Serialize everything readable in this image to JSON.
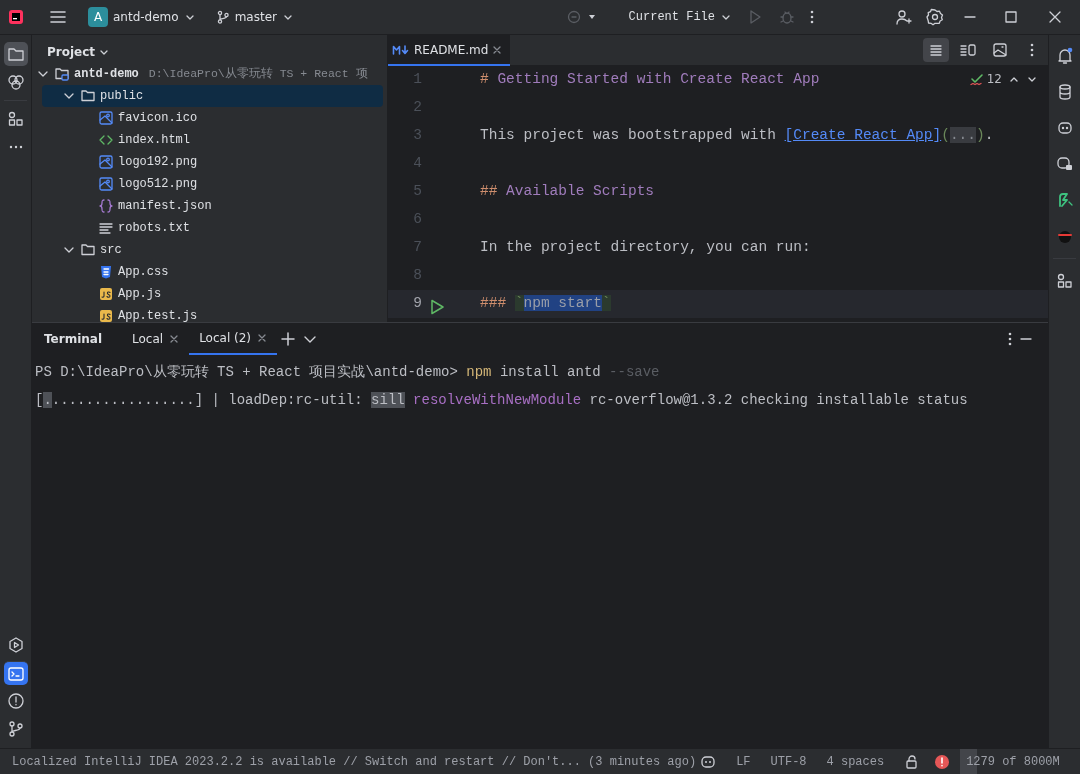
{
  "title_bar": {
    "project_badge": "A",
    "project": "antd-demo",
    "branch": "master",
    "run_config": "Current File"
  },
  "left_toolbar": [
    {
      "kind": "project",
      "selected": true
    },
    {
      "kind": "plugins",
      "selected": false
    },
    {
      "kind": "structure",
      "selected": false
    },
    {
      "kind": "more",
      "selected": false
    }
  ],
  "left_toolbar_bottom": [
    {
      "kind": "run",
      "selected": false
    },
    {
      "kind": "terminal",
      "selected": true
    },
    {
      "kind": "problems",
      "selected": false
    },
    {
      "kind": "git",
      "selected": false
    }
  ],
  "project_panel": {
    "title": "Project",
    "tree": [
      {
        "kind": "module",
        "name": "antd-demo",
        "path": "D:\\IdeaPro\\从零玩转 TS + React 项",
        "expanded": true,
        "selected": false,
        "children": [
          {
            "kind": "folder",
            "name": "public",
            "expanded": true,
            "selected": true,
            "children": [
              {
                "kind": "image",
                "name": "favicon.ico",
                "selected": false
              },
              {
                "kind": "html",
                "name": "index.html",
                "selected": false
              },
              {
                "kind": "image",
                "name": "logo192.png",
                "selected": false
              },
              {
                "kind": "image",
                "name": "logo512.png",
                "selected": false
              },
              {
                "kind": "json",
                "name": "manifest.json",
                "selected": false
              },
              {
                "kind": "text",
                "name": "robots.txt",
                "selected": false
              }
            ]
          },
          {
            "kind": "folder",
            "name": "src",
            "expanded": true,
            "selected": false,
            "children": [
              {
                "kind": "css",
                "name": "App.css",
                "selected": false
              },
              {
                "kind": "js",
                "name": "App.js",
                "selected": false
              },
              {
                "kind": "js",
                "name": "App.test.js",
                "selected": false
              }
            ]
          }
        ]
      }
    ]
  },
  "editor": {
    "tabs": [
      {
        "label": "README.md",
        "selected": true
      }
    ],
    "inspections": "12",
    "lines": [
      {
        "number": "1",
        "current": false,
        "segments": [
          {
            "kind": "marker",
            "text": "# "
          },
          {
            "kind": "heading",
            "text": "Getting Started with Create React App"
          }
        ]
      },
      {
        "number": "2",
        "current": false
      },
      {
        "number": "3",
        "current": false,
        "segments": [
          {
            "kind": "plain",
            "text": "This project was bootstrapped with "
          },
          {
            "kind": "link",
            "text": "[Create React App]"
          },
          {
            "kind": "muted",
            "text": "("
          },
          {
            "kind": "fold",
            "text": "..."
          },
          {
            "kind": "muted",
            "text": ")"
          },
          {
            "kind": "plain",
            "text": "."
          }
        ]
      },
      {
        "number": "4",
        "current": false
      },
      {
        "number": "5",
        "current": false,
        "segments": [
          {
            "kind": "marker",
            "text": "## "
          },
          {
            "kind": "heading",
            "text": "Available Scripts"
          }
        ]
      },
      {
        "number": "6",
        "current": false
      },
      {
        "number": "7",
        "current": false,
        "segments": [
          {
            "kind": "plain",
            "text": "In the project directory, you can run:"
          }
        ]
      },
      {
        "number": "8",
        "current": false
      },
      {
        "number": "9",
        "current": true,
        "run": true,
        "segments": [
          {
            "kind": "marker",
            "text": "### "
          },
          {
            "kind": "tick",
            "text": "`"
          },
          {
            "kind": "selected",
            "text": "npm start"
          },
          {
            "kind": "tick",
            "text": "`"
          }
        ]
      }
    ]
  },
  "right_toolbar": [
    {
      "kind": "notifications"
    },
    {
      "kind": "database"
    },
    {
      "kind": "assistant"
    },
    {
      "kind": "assistant-chat"
    },
    {
      "kind": "ai"
    },
    {
      "kind": "ninja"
    },
    {
      "kind": "structure"
    }
  ],
  "terminal": {
    "title": "Terminal",
    "tabs": [
      {
        "label": "Local",
        "selected": false
      },
      {
        "label": "Local (2)",
        "selected": true
      }
    ],
    "lines": [
      [
        {
          "kind": "plain",
          "text": "PS D:\\IdeaPro\\从零玩转 TS + React 项目实战\\antd-demo> "
        },
        {
          "kind": "command",
          "text": "npm"
        },
        {
          "kind": "plain",
          "text": " install antd "
        },
        {
          "kind": "dim",
          "text": "--save"
        }
      ],
      [
        {
          "kind": "plain",
          "text": "["
        },
        {
          "kind": "highlight",
          "text": "."
        },
        {
          "kind": "plain",
          "text": ".................] | loadDep:rc-util: "
        },
        {
          "kind": "highlight",
          "text": "sill"
        },
        {
          "kind": "purple",
          "text": " resolveWithNewModule"
        },
        {
          "kind": "plain",
          "text": " rc-overflow@1.3.2 checking installable status"
        }
      ]
    ]
  },
  "status_bar": {
    "message": "Localized IntelliJ IDEA 2023.2.2 is available // Switch and restart // Don't... (3 minutes ago)",
    "items": [
      "LF",
      "UTF-8",
      "4 spaces"
    ],
    "memory": "1279 of 8000M"
  }
}
